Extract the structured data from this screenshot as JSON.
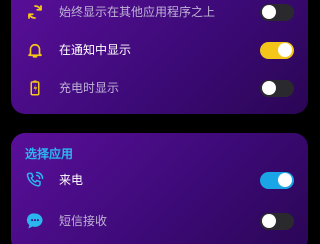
{
  "settings": {
    "items": [
      {
        "label": "始终显示在其他应用程序之上",
        "icon": "sync-icon",
        "enabled": false
      },
      {
        "label": "在通知中显示",
        "icon": "bell-icon",
        "enabled": true
      },
      {
        "label": "充电时显示",
        "icon": "battery-charging-icon",
        "enabled": false
      }
    ]
  },
  "apps_section": {
    "title": "选择应用",
    "items": [
      {
        "label": "来电",
        "icon": "phone-ringing-icon",
        "enabled": true
      },
      {
        "label": "短信接收",
        "icon": "message-icon",
        "enabled": false
      }
    ]
  },
  "colors": {
    "card_gradient_start": "#5a0f9a",
    "card_gradient_end": "#2a0655",
    "accent_yellow": "#f4c61a",
    "accent_blue": "#1aa6e6",
    "section_title": "#2bb6f0"
  }
}
